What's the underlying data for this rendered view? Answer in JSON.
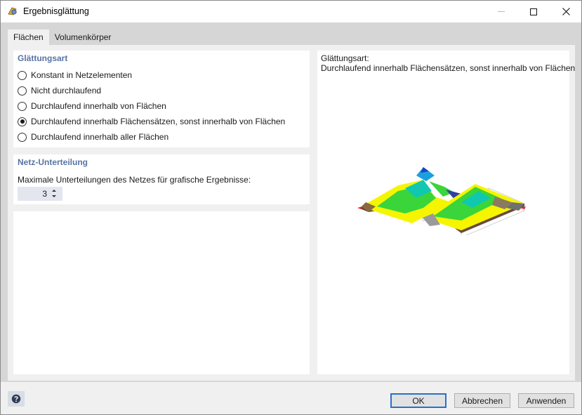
{
  "window": {
    "title": "Ergebnisglättung"
  },
  "tabs": [
    {
      "label": "Flächen",
      "active": true
    },
    {
      "label": "Volumenkörper",
      "active": false
    }
  ],
  "smoothing": {
    "title": "Glättungsart",
    "options": [
      {
        "label": "Konstant in Netzelementen",
        "checked": false
      },
      {
        "label": "Nicht durchlaufend",
        "checked": false
      },
      {
        "label": "Durchlaufend innerhalb von Flächen",
        "checked": false
      },
      {
        "label": "Durchlaufend innerhalb Flächensätzen, sonst innerhalb von Flächen",
        "checked": true
      },
      {
        "label": "Durchlaufend innerhalb aller Flächen",
        "checked": false
      }
    ]
  },
  "mesh": {
    "title": "Netz-Unterteilung",
    "label": "Maximale Unterteilungen des Netzes für grafische Ergebnisse:",
    "value": "3"
  },
  "preview": {
    "caption_line1": "Glättungsart:",
    "caption_line2": "Durchlaufend innerhalb Flächensätzen, sonst innerhalb von Flächen"
  },
  "buttons": {
    "ok": "OK",
    "cancel": "Abbrechen",
    "apply": "Anwenden"
  },
  "colors": {
    "group_title": "#5874a4",
    "accent_default_button": "#2a6fc9"
  }
}
